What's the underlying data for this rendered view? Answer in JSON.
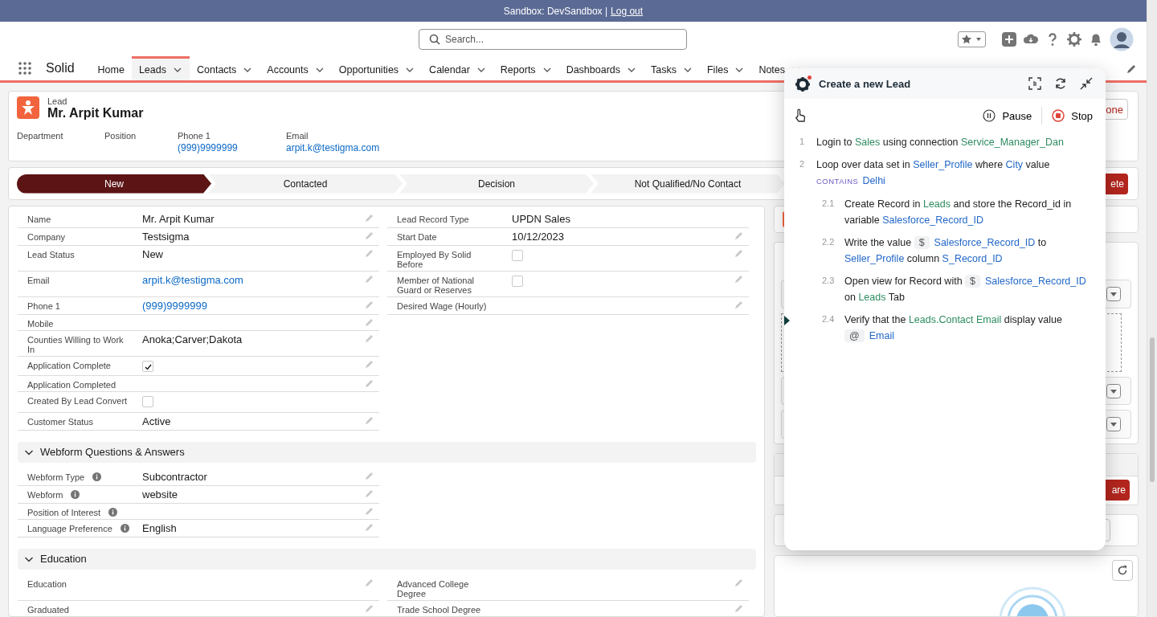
{
  "banner": {
    "text": "Sandbox: DevSandbox |",
    "link": "Log out"
  },
  "search": {
    "placeholder": "Search..."
  },
  "app": {
    "name": "Solid"
  },
  "nav_tabs": [
    {
      "label": "Home",
      "selected": false,
      "has_menu": false
    },
    {
      "label": "Leads",
      "selected": true,
      "has_menu": true
    },
    {
      "label": "Contacts",
      "selected": false,
      "has_menu": true
    },
    {
      "label": "Accounts",
      "selected": false,
      "has_menu": true
    },
    {
      "label": "Opportunities",
      "selected": false,
      "has_menu": true
    },
    {
      "label": "Calendar",
      "selected": false,
      "has_menu": true
    },
    {
      "label": "Reports",
      "selected": false,
      "has_menu": true
    },
    {
      "label": "Dashboards",
      "selected": false,
      "has_menu": true
    },
    {
      "label": "Tasks",
      "selected": false,
      "has_menu": true
    },
    {
      "label": "Files",
      "selected": false,
      "has_menu": true
    },
    {
      "label": "Notes",
      "selected": false,
      "has_menu": true
    }
  ],
  "record": {
    "object": "Lead",
    "title": "Mr. Arpit Kumar",
    "button": "one",
    "fields": [
      {
        "label": "Department"
      },
      {
        "label": "Position"
      },
      {
        "label": "Phone 1",
        "value": "(999)9999999",
        "kind": "link"
      },
      {
        "label": "Email",
        "value": "arpit.k@testigma.com",
        "kind": "link"
      }
    ]
  },
  "path": {
    "stages": [
      {
        "label": "New",
        "selected": true
      },
      {
        "label": "Contacted",
        "selected": false
      },
      {
        "label": "Decision",
        "selected": false
      },
      {
        "label": "Not Qualified/No Contact",
        "selected": false
      }
    ],
    "button": "ete"
  },
  "details": {
    "left": [
      {
        "label": "Name",
        "value": "Mr. Arpit Kumar",
        "kind": "text",
        "editable": true
      },
      {
        "label": "Company",
        "value": "Testsigma",
        "kind": "text",
        "editable": true
      },
      {
        "label": "Lead Status",
        "value": "New",
        "kind": "text",
        "editable": true
      },
      {
        "label": "Email",
        "value": "arpit.k@testigma.com",
        "kind": "link",
        "editable": true
      },
      {
        "label": "Phone 1",
        "value": "(999)9999999",
        "kind": "link",
        "editable": true
      },
      {
        "label": "Mobile",
        "editable": true
      },
      {
        "label": "Counties Willing to Work In",
        "value": "Anoka;Carver;Dakota",
        "kind": "text",
        "editable": true
      },
      {
        "label": "Application Complete",
        "kind": "checkbox",
        "checked": true,
        "editable": true
      },
      {
        "label": "Application Completed",
        "editable": true
      },
      {
        "label": "Created By Lead Convert",
        "kind": "checkbox",
        "checked": false,
        "editable": false
      },
      {
        "label": "Customer Status",
        "value": "Active",
        "kind": "text",
        "editable": true
      }
    ],
    "right": [
      {
        "label": "Lead Record Type",
        "value": "UPDN Sales",
        "kind": "text",
        "editable": false
      },
      {
        "label": "Start Date",
        "value": "10/12/2023",
        "kind": "text",
        "editable": true
      },
      {
        "label": "Employed By Solid Before",
        "kind": "checkbox",
        "checked": false,
        "editable": true
      },
      {
        "label": "Member of National Guard or Reserves",
        "kind": "checkbox",
        "checked": false,
        "editable": true
      },
      {
        "label": "Desired Wage (Hourly)",
        "editable": true
      }
    ]
  },
  "sections": [
    {
      "title": "Webform Questions & Answers",
      "expanded": true,
      "left": [
        {
          "label": "Webform Type",
          "info": true,
          "value": "Subcontractor",
          "kind": "text",
          "editable": true
        },
        {
          "label": "Webform",
          "info": true,
          "value": "website",
          "kind": "text",
          "editable": true
        },
        {
          "label": "Position of Interest",
          "info": true,
          "editable": true
        },
        {
          "label": "Language Preference",
          "info": true,
          "value": "English",
          "kind": "text",
          "editable": true
        }
      ]
    },
    {
      "title": "Education",
      "expanded": true,
      "left": [
        {
          "label": "Education",
          "editable": true
        },
        {
          "label": "Graduated",
          "editable": true
        }
      ],
      "right": [
        {
          "label": "Advanced College Degree",
          "editable": true
        },
        {
          "label": "Trade School Degree",
          "editable": true
        }
      ]
    }
  ],
  "side": {
    "button": "are"
  },
  "assistant": {
    "title": "Create a new Lead",
    "controls": [
      {
        "label": "Pause",
        "kind": "pause"
      },
      {
        "label": "Stop",
        "kind": "stop"
      }
    ],
    "steps": [
      {
        "number": "1",
        "current": false,
        "parts": [
          {
            "kind": "text",
            "text": "Login to "
          },
          {
            "kind": "entity",
            "text": "Sales"
          },
          {
            "kind": "text",
            "text": " using connection "
          },
          {
            "kind": "entity",
            "text": "Service_Manager_Dan"
          }
        ]
      },
      {
        "number": "2",
        "current": false,
        "parts": [
          {
            "kind": "text",
            "text": "Loop over data set in "
          },
          {
            "kind": "value",
            "text": "Seller_Profile"
          },
          {
            "kind": "text",
            "text": " where "
          },
          {
            "kind": "value",
            "text": "City"
          },
          {
            "kind": "text",
            "text": " value "
          },
          {
            "kind": "operator",
            "text": "CONTAINS"
          },
          {
            "kind": "value",
            "text": "Delhi"
          }
        ],
        "children": [
          {
            "number": "2.1",
            "current": false,
            "parts": [
              {
                "kind": "text",
                "text": "Create Record in "
              },
              {
                "kind": "entity",
                "text": "Leads"
              },
              {
                "kind": "text",
                "text": " and store the Record_id in variable "
              },
              {
                "kind": "value",
                "text": "Salesforce_Record_ID"
              }
            ]
          },
          {
            "number": "2.2",
            "current": false,
            "parts": [
              {
                "kind": "text",
                "text": "Write the value "
              },
              {
                "kind": "chip",
                "text": "$"
              },
              {
                "kind": "value",
                "text": "Salesforce_Record_ID"
              },
              {
                "kind": "text",
                "text": " to "
              },
              {
                "kind": "value",
                "text": "Seller_Profile"
              },
              {
                "kind": "text",
                "text": " column "
              },
              {
                "kind": "value",
                "text": "S_Record_ID"
              }
            ]
          },
          {
            "number": "2.3",
            "current": false,
            "parts": [
              {
                "kind": "text",
                "text": "Open view for Record with "
              },
              {
                "kind": "chip",
                "text": "$"
              },
              {
                "kind": "value",
                "text": "Salesforce_Record_ID"
              },
              {
                "kind": "text",
                "text": " on "
              },
              {
                "kind": "entity",
                "text": "Leads"
              },
              {
                "kind": "text",
                "text": " Tab"
              }
            ]
          },
          {
            "number": "2.4",
            "current": true,
            "parts": [
              {
                "kind": "text",
                "text": "Verify that the "
              },
              {
                "kind": "entity",
                "text": "Leads.Contact Email"
              },
              {
                "kind": "text",
                "text": " display value "
              },
              {
                "kind": "chip",
                "text": "@"
              },
              {
                "kind": "value",
                "text": "Email"
              }
            ]
          }
        ]
      }
    ]
  }
}
